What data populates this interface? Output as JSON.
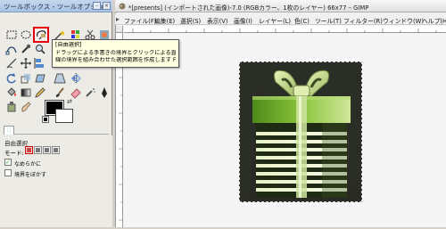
{
  "toolbox": {
    "title": "ツールボックス - ツールオプション",
    "tool_options": {
      "title": "自由選択",
      "mode_label": "モード:",
      "antialias_label": "なめらかに",
      "feather_label": "境界をぼかす",
      "antialias_checked": true,
      "feather_checked": false
    },
    "colors": {
      "foreground": "#000000",
      "background": "#ffffff"
    }
  },
  "tooltip": {
    "line1": "[自由選択]",
    "line2": "ドラッグによる手書きの境界とクリックによる直",
    "line3": "線の境界を組み合わせた選択範囲を作成します F"
  },
  "image_window": {
    "title": "*[presents] (インポートされた画像)-7.0 (RGBカラー、1枚のレイヤー) 66x77 – GIMP",
    "menu": [
      "ファイル(F)",
      "編集(E)",
      "選択(S)",
      "表示(V)",
      "画像(I)",
      "レイヤー(L)",
      "色(C)",
      "ツール(T)",
      "フィルター(R)",
      "ウィンドウ(W)",
      "ヘルプ(H)"
    ]
  },
  "icons": {
    "tool_rect_select": "rect-select-icon",
    "tool_ellipse_select": "ellipse-select-icon",
    "tool_free_select": "lasso-icon",
    "tool_fuzzy_select": "magic-wand-icon",
    "accent_highlight": "#e60012"
  }
}
